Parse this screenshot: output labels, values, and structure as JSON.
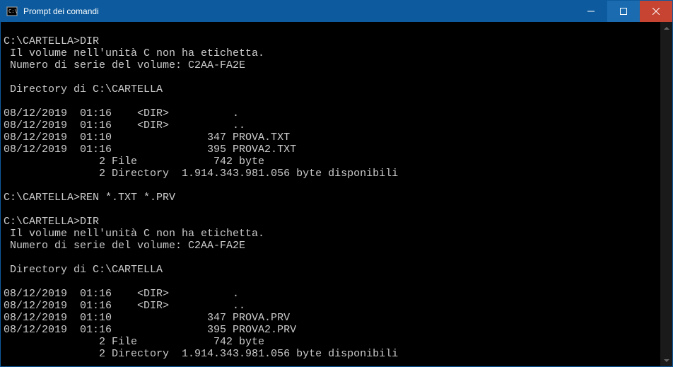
{
  "window": {
    "title": "Prompt dei comandi"
  },
  "terminal": {
    "content": "\nC:\\CARTELLA>DIR\n Il volume nell'unità C non ha etichetta.\n Numero di serie del volume: C2AA-FA2E\n\n Directory di C:\\CARTELLA\n\n08/12/2019  01:16    <DIR>          .\n08/12/2019  01:16    <DIR>          ..\n08/12/2019  01:10               347 PROVA.TXT\n08/12/2019  01:16               395 PROVA2.TXT\n               2 File            742 byte\n               2 Directory  1.914.343.981.056 byte disponibili\n\nC:\\CARTELLA>REN *.TXT *.PRV\n\nC:\\CARTELLA>DIR\n Il volume nell'unità C non ha etichetta.\n Numero di serie del volume: C2AA-FA2E\n\n Directory di C:\\CARTELLA\n\n08/12/2019  01:16    <DIR>          .\n08/12/2019  01:16    <DIR>          ..\n08/12/2019  01:10               347 PROVA.PRV\n08/12/2019  01:16               395 PROVA2.PRV\n               2 File            742 byte\n               2 Directory  1.914.343.981.056 byte disponibili\n\nC:\\CARTELLA>"
  }
}
